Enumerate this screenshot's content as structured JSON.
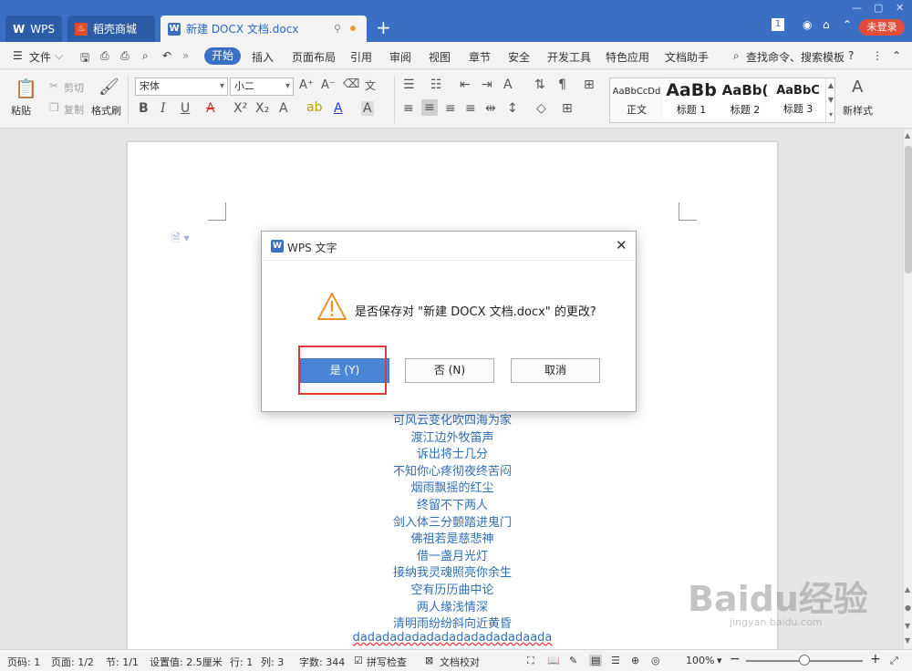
{
  "titlebar": {
    "tabs": [
      {
        "label": "WPS",
        "icon": "wps-logo-icon"
      },
      {
        "label": "稻壳商城",
        "icon": "docer-store-icon"
      },
      {
        "label": "新建 DOCX 文档.docx",
        "icon": "wps-writer-doc-icon"
      }
    ],
    "new_tab": "+",
    "page_badge": "1",
    "login_label": "未登录",
    "accent_color": "#3a6fc4"
  },
  "menubar": {
    "file_label": "文件",
    "items": [
      "开始",
      "插入",
      "页面布局",
      "引用",
      "审阅",
      "视图",
      "章节",
      "安全",
      "开发工具",
      "特色应用",
      "文档助手"
    ],
    "active": "开始",
    "search_label": "查找命令、搜索模板",
    "help": "?"
  },
  "ribbon": {
    "paste": "粘贴",
    "cut": "剪切",
    "copy": "复制",
    "format_painter": "格式刷",
    "font_name": "宋体",
    "font_size": "小二",
    "styles": [
      {
        "sample": "AaBbCcDd",
        "label": "正文"
      },
      {
        "sample": "AaBb",
        "label": "标题 1"
      },
      {
        "sample": "AaBb(",
        "label": "标题 2"
      },
      {
        "sample": "AaBbC",
        "label": "标题 3"
      }
    ],
    "new_style": "新样式"
  },
  "document": {
    "lines": [
      "可风云变化吹四海为家",
      "渡江边外牧笛声",
      "诉出将士几分",
      "不知你心疼彻夜终苦闷",
      "烟雨飘摇的红尘",
      "终留不下两人",
      "剑入体三分颤踏进鬼门",
      "佛祖若是慈悲神",
      "借一盏月光灯",
      "接纳我灵魂照亮你余生",
      "空有历历曲中论",
      "两人缘浅情深",
      "清明雨纷纷斜向近黄昏",
      "dadadadadadadadadadadadaada"
    ],
    "text_color": "#2f6fb5"
  },
  "dialog": {
    "title": "WPS 文字",
    "message": "是否保存对 \"新建 DOCX 文档.docx\" 的更改?",
    "yes": "是 (Y)",
    "no": "否 (N)",
    "cancel": "取消",
    "warning_color": "#e8952e"
  },
  "statusbar": {
    "page_num": "页码: 1",
    "pages": "页面: 1/2",
    "section": "节: 1/1",
    "setting": "设置值: 2.5厘米",
    "row": "行: 1",
    "col": "列: 3",
    "words": "字数: 344",
    "spell_check": "拼写检查",
    "doc_proof": "文档校对",
    "zoom": "100%",
    "zoom_level": 1.0
  },
  "watermark": {
    "text": "Baidu经验",
    "sub": "jingyan.baidu.com"
  }
}
